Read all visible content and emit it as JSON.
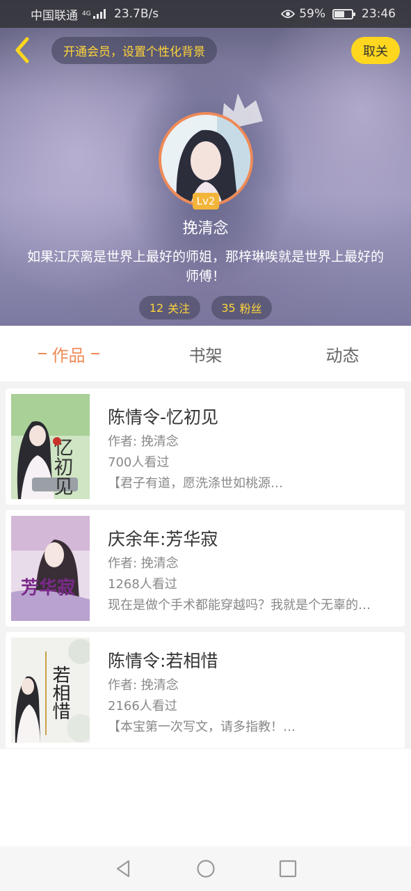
{
  "status_bar": {
    "carrier": "中国联通",
    "network": "4G",
    "speed": "23.7B/s",
    "battery": "59%",
    "battery_level": 0.59,
    "time": "23:46"
  },
  "header": {
    "vip_banner": "开通会员，设置个性化背景",
    "unfollow_label": "取关",
    "level": "Lv2",
    "username": "挽清念",
    "bio": "如果江厌离是世界上最好的师姐，那梓琳唉就是世界上最好的师傅！",
    "following_count": "12",
    "following_label": "关注",
    "fans_count": "35",
    "fans_label": "粉丝"
  },
  "tabs": [
    {
      "label": "作品",
      "active": true
    },
    {
      "label": "书架",
      "active": false
    },
    {
      "label": "动态",
      "active": false
    }
  ],
  "books": [
    {
      "title": "陈情令-忆初见",
      "author": "作者: 挽清念",
      "views": "700人看过",
      "intro": "【君子有道，愿洗涤世如桃源…",
      "cover_text": "忆初见"
    },
    {
      "title": "庆余年:芳华寂",
      "author": "作者: 挽清念",
      "views": "1268人看过",
      "intro": "现在是做个手术都能穿越吗？我就是个无辜的…",
      "cover_text": "芳华寂"
    },
    {
      "title": "陈情令:若相惜",
      "author": "作者: 挽清念",
      "views": "2166人看过",
      "intro": "【本宝第一次写文，请多指教！…",
      "cover_text": "若相惜"
    }
  ],
  "colors": {
    "accent": "#ef8a57",
    "highlight": "#ffd43a",
    "button_yellow": "#ffd71e"
  },
  "icons": {
    "back": "chevron-left-icon",
    "crown": "crown-icon",
    "nav_back": "triangle-back-icon",
    "nav_home": "circle-home-icon",
    "nav_recent": "square-recent-icon"
  }
}
